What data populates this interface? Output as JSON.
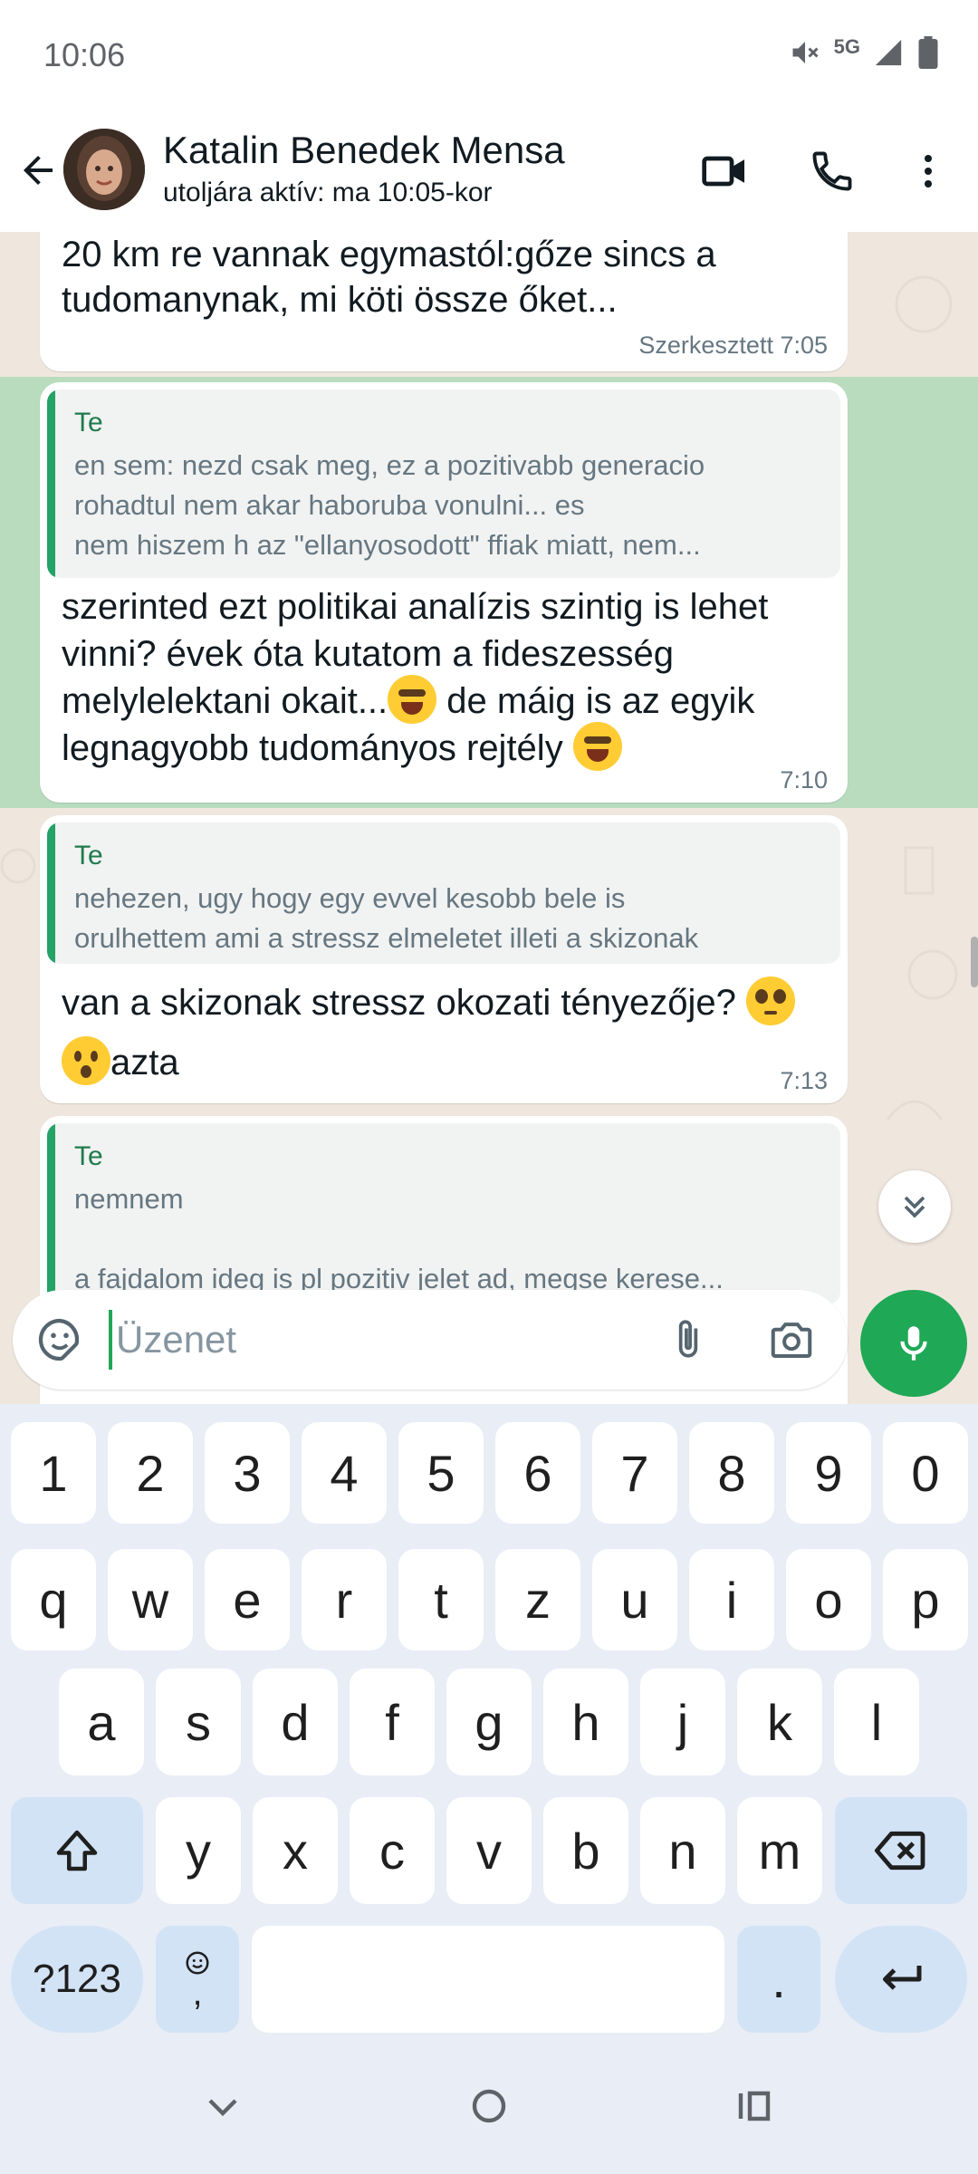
{
  "status_bar": {
    "time": "10:06",
    "network": "5G"
  },
  "header": {
    "contact_name": "Katalin Benedek Mensa",
    "last_seen": "utoljára aktív: ma 10:05-kor"
  },
  "messages": [
    {
      "text": "20 km re vannak egymastól:gőze sincs a tudomanynak, mi köti össze őket...",
      "meta": "Szerkesztett 7:05"
    },
    {
      "quote_author": "Te",
      "quote_lines": [
        "en sem: nezd csak meg, ez a pozitivabb generacio",
        "rohadtul nem akar haboruba vonulni... es",
        "nem hiszem h az \"ellanyosodott\" ffiak miatt, nem..."
      ],
      "text_a": "szerinted ezt politikai analízis szintig is lehet vinni? évek óta kutatom a fideszesség melylelektani okait...",
      "text_b": " de máig is az egyik legnagyobb tudományos rejtély ",
      "meta": "7:10"
    },
    {
      "quote_author": "Te",
      "quote_lines": [
        "nehezen, ugy hogy egy evvel kesobb bele is",
        "orulhettem ami a stressz elmeletet illeti a skizonak"
      ],
      "text_a": "van a skizonak stressz okozati tényezője? ",
      "text_b": "azta",
      "meta": "7:13"
    },
    {
      "quote_author": "Te",
      "quote_lines": [
        "nemnem",
        "",
        "a fajdalom ideg is pl pozitiv jelet ad, megse kerese..."
      ]
    }
  ],
  "composer": {
    "placeholder": "Üzenet"
  },
  "keyboard": {
    "row_numbers": [
      "1",
      "2",
      "3",
      "4",
      "5",
      "6",
      "7",
      "8",
      "9",
      "0"
    ],
    "row1": [
      "q",
      "w",
      "e",
      "r",
      "t",
      "z",
      "u",
      "i",
      "o",
      "p"
    ],
    "row2": [
      "a",
      "s",
      "d",
      "f",
      "g",
      "h",
      "j",
      "k",
      "l"
    ],
    "row3": [
      "y",
      "x",
      "c",
      "v",
      "b",
      "n",
      "m"
    ],
    "symbols_key": "?123",
    "comma_key": ",",
    "period_key": "."
  },
  "icons": {
    "back": "arrow-left-icon",
    "video": "video-call-icon",
    "phone": "phone-icon",
    "menu": "more-vert-icon",
    "sticker": "sticker-icon",
    "attach": "paperclip-icon",
    "camera": "camera-icon",
    "mic": "mic-icon",
    "scroll_down": "double-chevron-down-icon",
    "shift": "shift-icon",
    "backspace": "backspace-icon",
    "enter": "enter-icon",
    "emoji_key": "emoji-icon"
  },
  "colors": {
    "accent_green": "#1fa855",
    "quote_bar": "#25a266",
    "chat_bg": "#efe7de",
    "highlight": "#b8dcbd"
  }
}
